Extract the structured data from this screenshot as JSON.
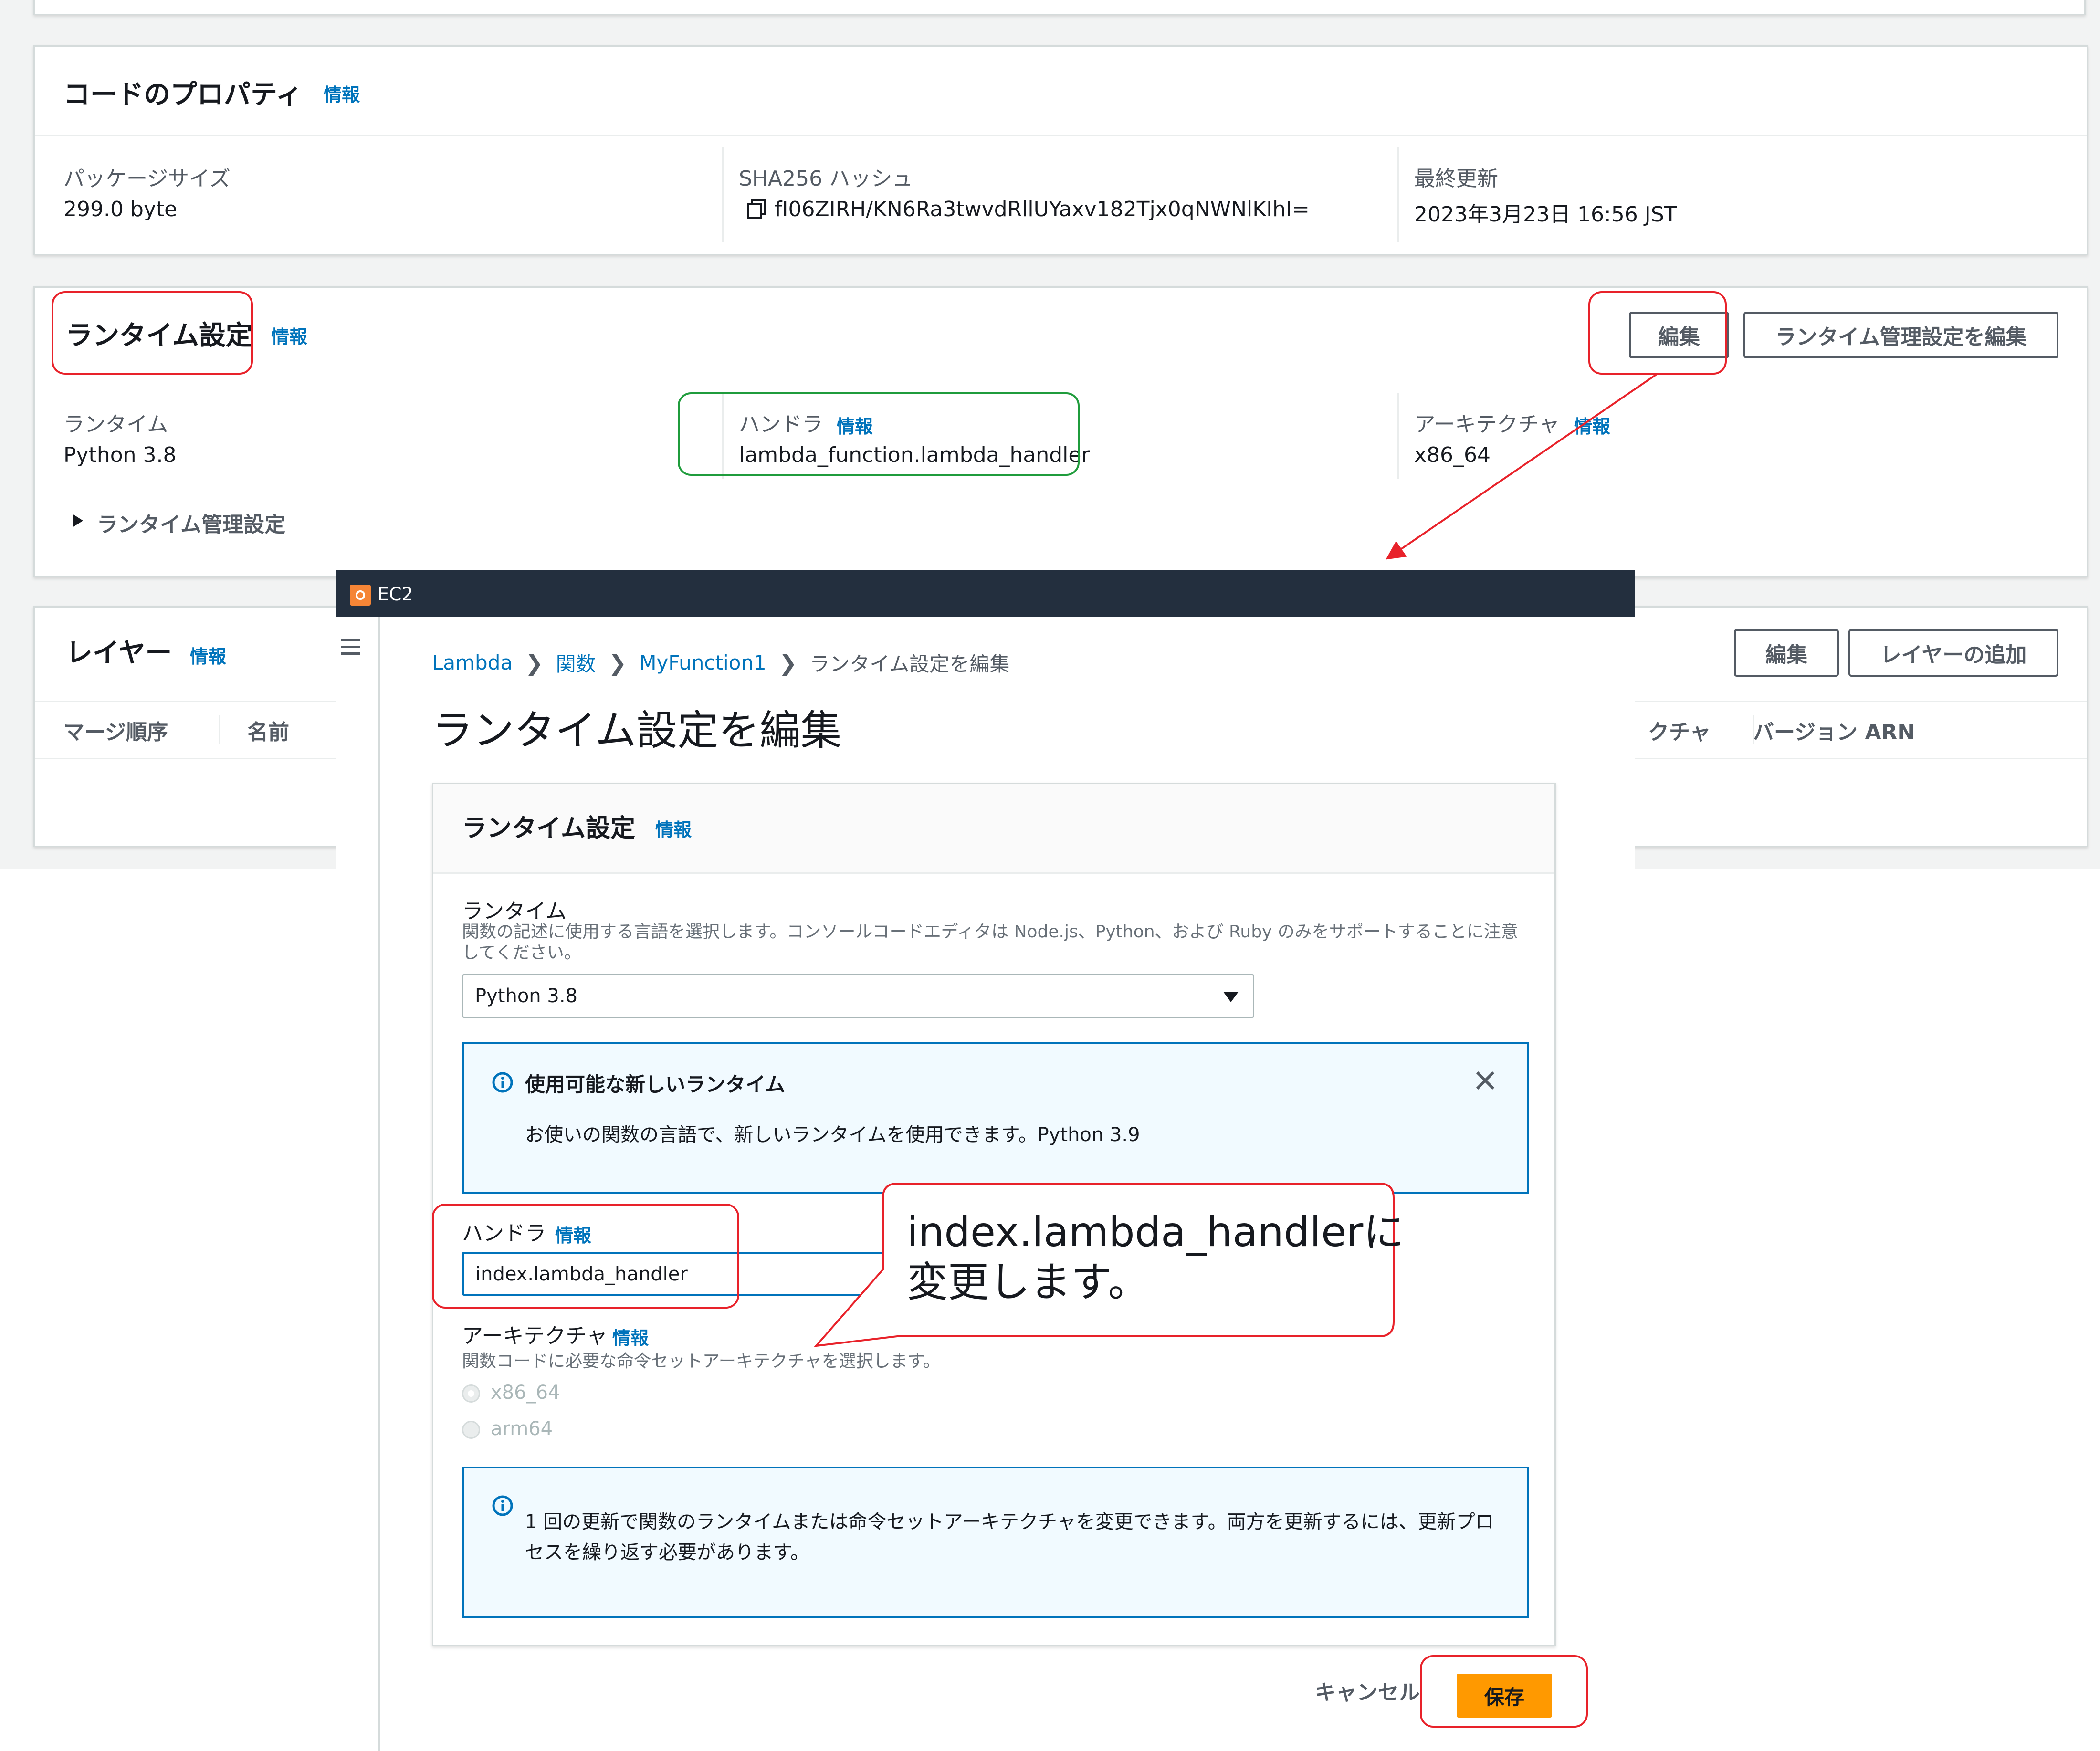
{
  "code_properties": {
    "title": "コードのプロパティ",
    "info": "情報",
    "package_size_label": "パッケージサイズ",
    "package_size_value": "299.0 byte",
    "sha_label": "SHA256 ハッシュ",
    "sha_value": "fI06ZIRH/KN6Ra3twvdRllUYaxv182Tjx0qNWNlKIhI=",
    "last_modified_label": "最終更新",
    "last_modified_value": "2023年3月23日 16:56 JST"
  },
  "runtime_settings": {
    "title": "ランタイム設定",
    "info": "情報",
    "edit_button": "編集",
    "edit_runtime_mgmt_button": "ランタイム管理設定を編集",
    "runtime_label": "ランタイム",
    "runtime_value": "Python 3.8",
    "handler_label": "ハンドラ",
    "handler_info": "情報",
    "handler_value": "lambda_function.lambda_handler",
    "arch_label": "アーキテクチャ",
    "arch_info": "情報",
    "arch_value": "x86_64",
    "mgmt_toggle": "ランタイム管理設定"
  },
  "layers": {
    "title": "レイヤー",
    "info": "情報",
    "edit_button": "編集",
    "add_button": "レイヤーの追加",
    "col_merge_order": "マージ順序",
    "col_name": "名前",
    "col_arch_partial": "クチャ",
    "col_version_arn": "バージョン ARN"
  },
  "overlay": {
    "service_name": "EC2",
    "menu_icon": "hamburger-menu-icon",
    "breadcrumbs": [
      "Lambda",
      "関数",
      "MyFunction1",
      "ランタイム設定を編集"
    ],
    "page_title": "ランタイム設定を編集",
    "panel_title": "ランタイム設定",
    "panel_info": "情報",
    "runtime_label": "ランタイム",
    "runtime_desc": "関数の記述に使用する言語を選択します。コンソールコードエディタは Node.js、Python、および Ruby のみをサポートすることに注意してください。",
    "runtime_select_value": "Python 3.8",
    "alert1_title": "使用可能な新しいランタイム",
    "alert1_body": "お使いの関数の言語で、新しいランタイムを使用できます。Python 3.9",
    "handler_label": "ハンドラ",
    "handler_info": "情報",
    "handler_value": "index.lambda_handler",
    "arch_label": "アーキテクチャ",
    "arch_info": "情報",
    "arch_desc": "関数コードに必要な命令セットアーキテクチャを選択します。",
    "arch_options": [
      "x86_64",
      "arm64"
    ],
    "alert2_body": "1 回の更新で関数のランタイムまたは命令セットアーキテクチャを変更できます。両方を更新するには、更新プロセスを繰り返す必要があります。",
    "cancel_button": "キャンセル",
    "save_button": "保存"
  },
  "callout": {
    "line1": "index.lambda_handlerに",
    "line2": "変更します。"
  },
  "colors": {
    "accent_link": "#0073bb",
    "save_button": "#ff9900",
    "topbar": "#232f3e",
    "highlight_red": "#e8222a",
    "highlight_green": "#1f9c3c"
  }
}
